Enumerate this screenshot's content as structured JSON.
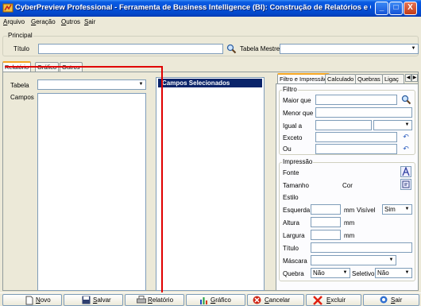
{
  "window": {
    "title": "CyberPreview Professional - Ferramenta de Business Intelligence (BI): Construção de Relatórios e Gráficos Per...",
    "buttons": {
      "minimize": "_",
      "maximize": "□",
      "close": "X"
    }
  },
  "menu": [
    "Arquivo",
    "Geração",
    "Outros",
    "Sair"
  ],
  "principal": {
    "legend": "Principal",
    "titulo_label": "Título",
    "titulo_value": "",
    "tabela_mestre_label": "Tabela Mestre",
    "tabela_mestre_value": ""
  },
  "tabs": [
    "Relatório",
    "Gráfico",
    "Outros"
  ],
  "left_panel": {
    "tabela_label": "Tabela",
    "tabela_value": "",
    "campos_label": "Campos"
  },
  "selected_fields_header": "Campos Selecionados",
  "right_tabs": [
    "Filtro e Impressão",
    "Calculado",
    "Quebras",
    "Ligaç"
  ],
  "filtro": {
    "legend": "Filtro",
    "maior_que": "Maior que",
    "menor_que": "Menor que",
    "igual_a": "Igual a",
    "exceto": "Exceto",
    "ou": "Ou"
  },
  "impressao": {
    "legend": "Impressão",
    "fonte": "Fonte",
    "tamanho": "Tamanho",
    "cor": "Cor",
    "estilo": "Estilo",
    "esquerda": "Esquerda",
    "mm1": "mm",
    "visivel": "Visível",
    "visivel_value": "Sim",
    "altura": "Altura",
    "mm2": "mm",
    "largura": "Largura",
    "mm3": "mm",
    "titulo": "Título",
    "mascara": "Máscara",
    "quebra": "Quebra",
    "quebra_value": "Não",
    "seletivo": "Seletivo",
    "seletivo_value": "Não"
  },
  "bottom_buttons": {
    "novo": "Novo",
    "salvar": "Salvar",
    "relatorio": "Relatório",
    "grafico": "Gráfico",
    "cancelar": "Cancelar",
    "excluir": "Excluir",
    "sair": "Sair"
  },
  "colors": {
    "titlebar": "#0550d8",
    "selection": "#0a246a",
    "window_bg": "#ece9d8",
    "annotation_red": "#e00000"
  }
}
